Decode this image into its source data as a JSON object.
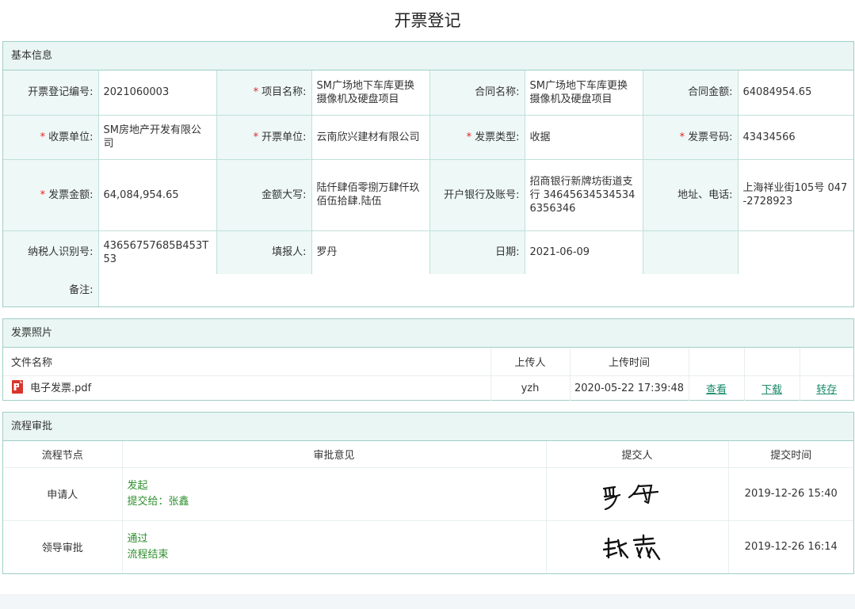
{
  "page_title": "开票登记",
  "basic": {
    "header": "基本信息",
    "rows": [
      [
        {
          "label": "开票登记编号:",
          "required": false,
          "value": "2021060003"
        },
        {
          "label": "项目名称:",
          "required": true,
          "value": "SM广场地下车库更换摄像机及硬盘项目"
        },
        {
          "label": "合同名称:",
          "required": false,
          "value": "SM广场地下车库更换摄像机及硬盘项目"
        },
        {
          "label": "合同金额:",
          "required": false,
          "value": "64084954.65"
        }
      ],
      [
        {
          "label": "收票单位:",
          "required": true,
          "value": "SM房地产开发有限公司"
        },
        {
          "label": "开票单位:",
          "required": true,
          "value": "云南欣兴建材有限公司"
        },
        {
          "label": "发票类型:",
          "required": true,
          "value": "收据"
        },
        {
          "label": "发票号码:",
          "required": true,
          "value": "43434566"
        }
      ],
      [
        {
          "label": "发票金额:",
          "required": true,
          "value": "64,084,954.65"
        },
        {
          "label": "金额大写:",
          "required": false,
          "value": "陆仟肆佰零捌万肆仟玖佰伍拾肆.陆伍"
        },
        {
          "label": "开户银行及账号:",
          "required": false,
          "value": "招商银行新牌坊街道支行 346456345345346356346"
        },
        {
          "label": "地址、电话:",
          "required": false,
          "value": "上海祥业街105号 047-2728923"
        }
      ],
      [
        {
          "label": "纳税人识别号:",
          "required": false,
          "value": "43656757685B453T53"
        },
        {
          "label": "填报人:",
          "required": false,
          "value": "罗丹"
        },
        {
          "label": "日期:",
          "required": false,
          "value": "2021-06-09"
        },
        {
          "label": "",
          "required": false,
          "value": ""
        }
      ]
    ],
    "remark_label": "备注:",
    "remark_value": ""
  },
  "attachments": {
    "header": "发票照片",
    "columns": {
      "name": "文件名称",
      "uploader": "上传人",
      "time": "上传时间"
    },
    "files": [
      {
        "name": "电子发票.pdf",
        "icon": "pdf-file-icon",
        "uploader": "yzh",
        "time": "2020-05-22 17:39:48",
        "view": "查看",
        "download": "下载",
        "transfer": "转存"
      }
    ]
  },
  "flow": {
    "header": "流程审批",
    "columns": {
      "node": "流程节点",
      "opinion": "审批意见",
      "submitter": "提交人",
      "time": "提交时间"
    },
    "rows": [
      {
        "node": "申请人",
        "opinion_line1": "发起",
        "opinion_line2": "提交给：张鑫",
        "signature": "罗丹",
        "time": "2019-12-26 15:40"
      },
      {
        "node": "领导审批",
        "opinion_line1": "通过",
        "opinion_line2": "流程结束",
        "signature": "张鑫",
        "time": "2019-12-26 16:14"
      }
    ]
  },
  "colors": {
    "accent": "#1a8a6a",
    "header_bg": "#eaf6f3",
    "border": "#9fcfc6",
    "required": "#e02424",
    "opinion": "#2f8f2f"
  }
}
